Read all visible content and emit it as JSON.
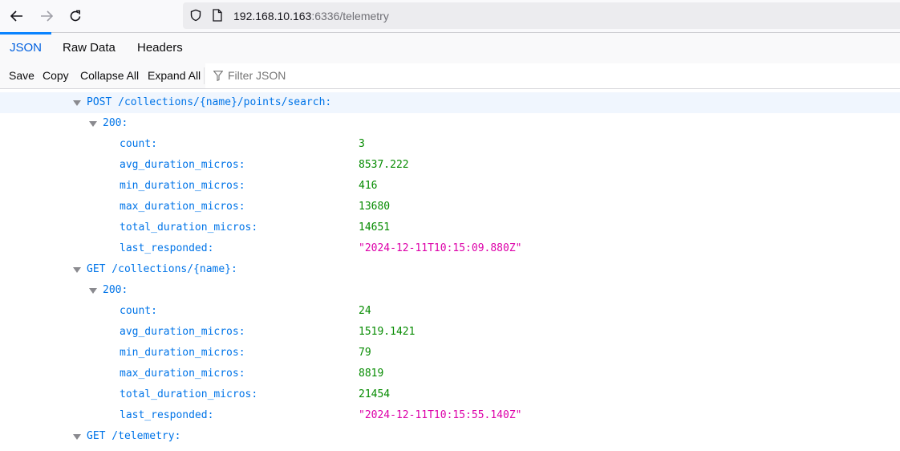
{
  "browser": {
    "url_host": "192.168.10.163",
    "url_rest": ":6336/telemetry",
    "icons": {
      "back": "arrow-left-icon",
      "forward": "arrow-right-icon",
      "reload": "reload-icon",
      "shield": "shield-icon",
      "page": "page-icon"
    }
  },
  "viewer": {
    "tabs": [
      {
        "label": "JSON",
        "active": true
      },
      {
        "label": "Raw Data",
        "active": false
      },
      {
        "label": "Headers",
        "active": false
      }
    ],
    "toolbar": {
      "save": "Save",
      "copy": "Copy",
      "collapse_all": "Collapse All",
      "expand_all": "Expand All",
      "filter_placeholder": "Filter JSON"
    }
  },
  "tree": [
    {
      "key": "POST /collections/{name}/points/search:",
      "level": 1,
      "expanded": true
    },
    {
      "key": "200:",
      "level": 2,
      "expanded": true
    },
    {
      "key": "count:",
      "level": 3,
      "value": "3",
      "type": "number"
    },
    {
      "key": "avg_duration_micros:",
      "level": 3,
      "value": "8537.222",
      "type": "number"
    },
    {
      "key": "min_duration_micros:",
      "level": 3,
      "value": "416",
      "type": "number"
    },
    {
      "key": "max_duration_micros:",
      "level": 3,
      "value": "13680",
      "type": "number"
    },
    {
      "key": "total_duration_micros:",
      "level": 3,
      "value": "14651",
      "type": "number"
    },
    {
      "key": "last_responded:",
      "level": 3,
      "value": "\"2024-12-11T10:15:09.880Z\"",
      "type": "string"
    },
    {
      "key": "GET /collections/{name}:",
      "level": 1,
      "expanded": true
    },
    {
      "key": "200:",
      "level": 2,
      "expanded": true
    },
    {
      "key": "count:",
      "level": 3,
      "value": "24",
      "type": "number"
    },
    {
      "key": "avg_duration_micros:",
      "level": 3,
      "value": "1519.1421",
      "type": "number"
    },
    {
      "key": "min_duration_micros:",
      "level": 3,
      "value": "79",
      "type": "number"
    },
    {
      "key": "max_duration_micros:",
      "level": 3,
      "value": "8819",
      "type": "number"
    },
    {
      "key": "total_duration_micros:",
      "level": 3,
      "value": "21454",
      "type": "number"
    },
    {
      "key": "last_responded:",
      "level": 3,
      "value": "\"2024-12-11T10:15:55.140Z\"",
      "type": "string"
    },
    {
      "key": "GET /telemetry:",
      "level": 1,
      "expanded": true
    }
  ],
  "colors": {
    "key": "#0074e8",
    "number": "#058b00",
    "string": "#dd00a9",
    "active_tab": "#0060df",
    "selected_row": "#f0f6fe"
  }
}
